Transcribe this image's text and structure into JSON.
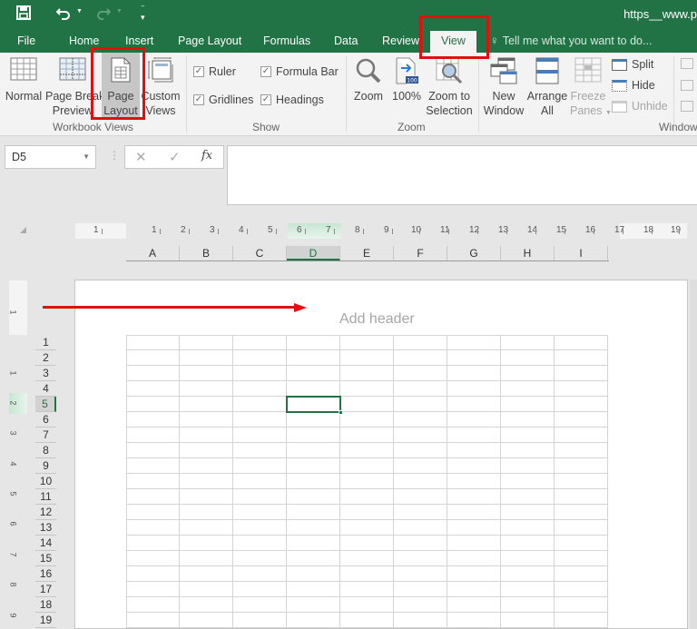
{
  "app": {
    "title": "https__www.p",
    "accent": "#217346",
    "annotation_color": "#e01010"
  },
  "qat": {
    "save_icon": "save-icon",
    "undo_icon": "undo-icon",
    "redo_icon": "redo-icon",
    "customize_icon": "customize-qat-icon"
  },
  "tabs": [
    {
      "label": "File"
    },
    {
      "label": "Home"
    },
    {
      "label": "Insert"
    },
    {
      "label": "Page Layout"
    },
    {
      "label": "Formulas"
    },
    {
      "label": "Data"
    },
    {
      "label": "Review"
    },
    {
      "label": "View",
      "active": true
    }
  ],
  "tell_me": {
    "placeholder": "Tell me what you want to do..."
  },
  "ribbon": {
    "workbook_views": {
      "label": "Workbook Views",
      "buttons": [
        {
          "line1": "Normal",
          "line2": ""
        },
        {
          "line1": "Page Break",
          "line2": "Preview"
        },
        {
          "line1": "Page",
          "line2": "Layout",
          "selected": true
        },
        {
          "line1": "Custom",
          "line2": "Views"
        }
      ]
    },
    "show": {
      "label": "Show",
      "checkboxes": [
        {
          "label": "Ruler",
          "checked": true
        },
        {
          "label": "Formula Bar",
          "checked": true
        },
        {
          "label": "Gridlines",
          "checked": true
        },
        {
          "label": "Headings",
          "checked": true
        }
      ]
    },
    "zoom": {
      "label": "Zoom",
      "buttons": [
        {
          "line1": "Zoom",
          "line2": ""
        },
        {
          "line1": "100%",
          "line2": ""
        },
        {
          "line1": "Zoom to",
          "line2": "Selection"
        }
      ],
      "badge": "100"
    },
    "window": {
      "label": "Window",
      "buttons": [
        {
          "line1": "New",
          "line2": "Window"
        },
        {
          "line1": "Arrange",
          "line2": "All"
        },
        {
          "line1": "Freeze",
          "line2": "Panes",
          "disabled": true
        }
      ],
      "small_buttons": [
        {
          "label": "Split"
        },
        {
          "label": "Hide"
        },
        {
          "label": "Unhide",
          "disabled": true
        }
      ]
    }
  },
  "formula_bar": {
    "name_box": "D5",
    "cancel": "✕",
    "enter": "✓",
    "fx": "fx",
    "value": ""
  },
  "ruler": {
    "horizontal": [
      "1",
      "1",
      "2",
      "3",
      "4",
      "5",
      "6",
      "7",
      "8",
      "9",
      "10",
      "11",
      "12",
      "13",
      "14",
      "15",
      "16",
      "17",
      "18",
      "19"
    ],
    "vertical": [
      "1",
      "1",
      "2",
      "3",
      "4",
      "5",
      "6",
      "7",
      "8",
      "9"
    ]
  },
  "sheet": {
    "columns": [
      "A",
      "B",
      "C",
      "D",
      "E",
      "F",
      "G",
      "H",
      "I"
    ],
    "rows": [
      "1",
      "2",
      "3",
      "4",
      "5",
      "6",
      "7",
      "8",
      "9",
      "10",
      "11",
      "12",
      "13",
      "14",
      "15",
      "16",
      "17",
      "18",
      "19"
    ],
    "selected_cell": "D5",
    "header_placeholder": "Add header"
  }
}
